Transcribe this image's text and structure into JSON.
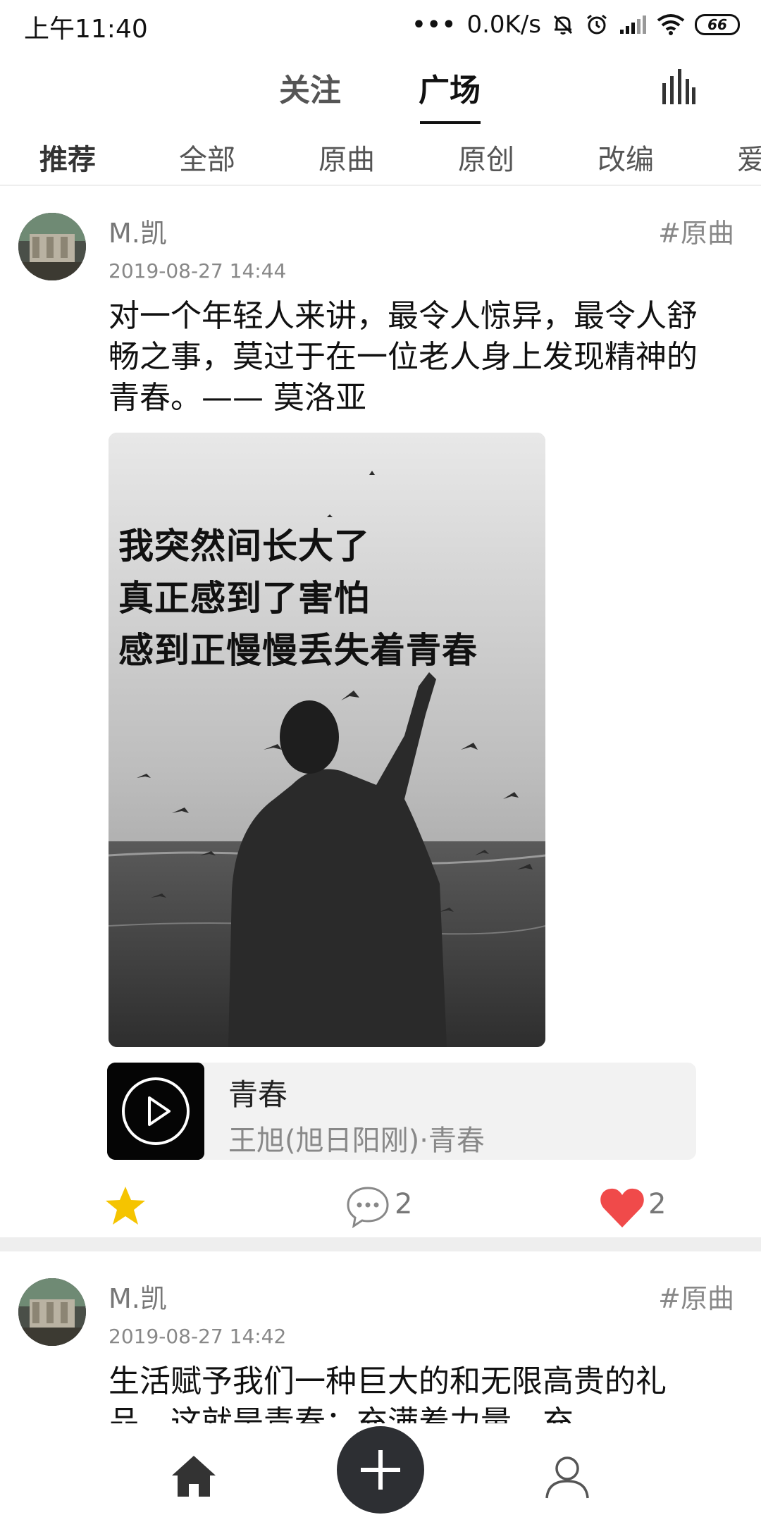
{
  "status_bar": {
    "time": "上午11:40",
    "net_speed": "0.0K/s",
    "battery": "66"
  },
  "top_tabs": [
    {
      "label": "关注",
      "active": false
    },
    {
      "label": "广场",
      "active": true
    }
  ],
  "categories": [
    "推荐",
    "全部",
    "原曲",
    "原创",
    "改编",
    "爱"
  ],
  "posts": [
    {
      "username": "M.凯",
      "tag": "#原曲",
      "time": "2019-08-27 14:44",
      "text": "对一个年轻人来讲，最令人惊异，最令人舒畅之事，莫过于在一位老人身上发现精神的青春。—— 莫洛亚",
      "image_text": [
        "我突然间长大了",
        "真正感到了害怕",
        "感到正慢慢丢失着青春"
      ],
      "music": {
        "title": "青春",
        "artist": "王旭(旭日阳刚)·青春"
      },
      "comments": "2",
      "likes": "2"
    },
    {
      "username": "M.凯",
      "tag": "#原曲",
      "time": "2019-08-27 14:42",
      "text": "生活赋予我们一种巨大的和无限高贵的礼品，这就是青春：充满着力量，充"
    }
  ],
  "colors": {
    "star": "#f5c400",
    "heart": "#f04a4a",
    "nav_add_bg": "#2d2f33"
  },
  "icons": {
    "top_right": "bars-chart-icon",
    "nav": [
      "home-icon",
      "add-icon",
      "profile-icon"
    ]
  }
}
